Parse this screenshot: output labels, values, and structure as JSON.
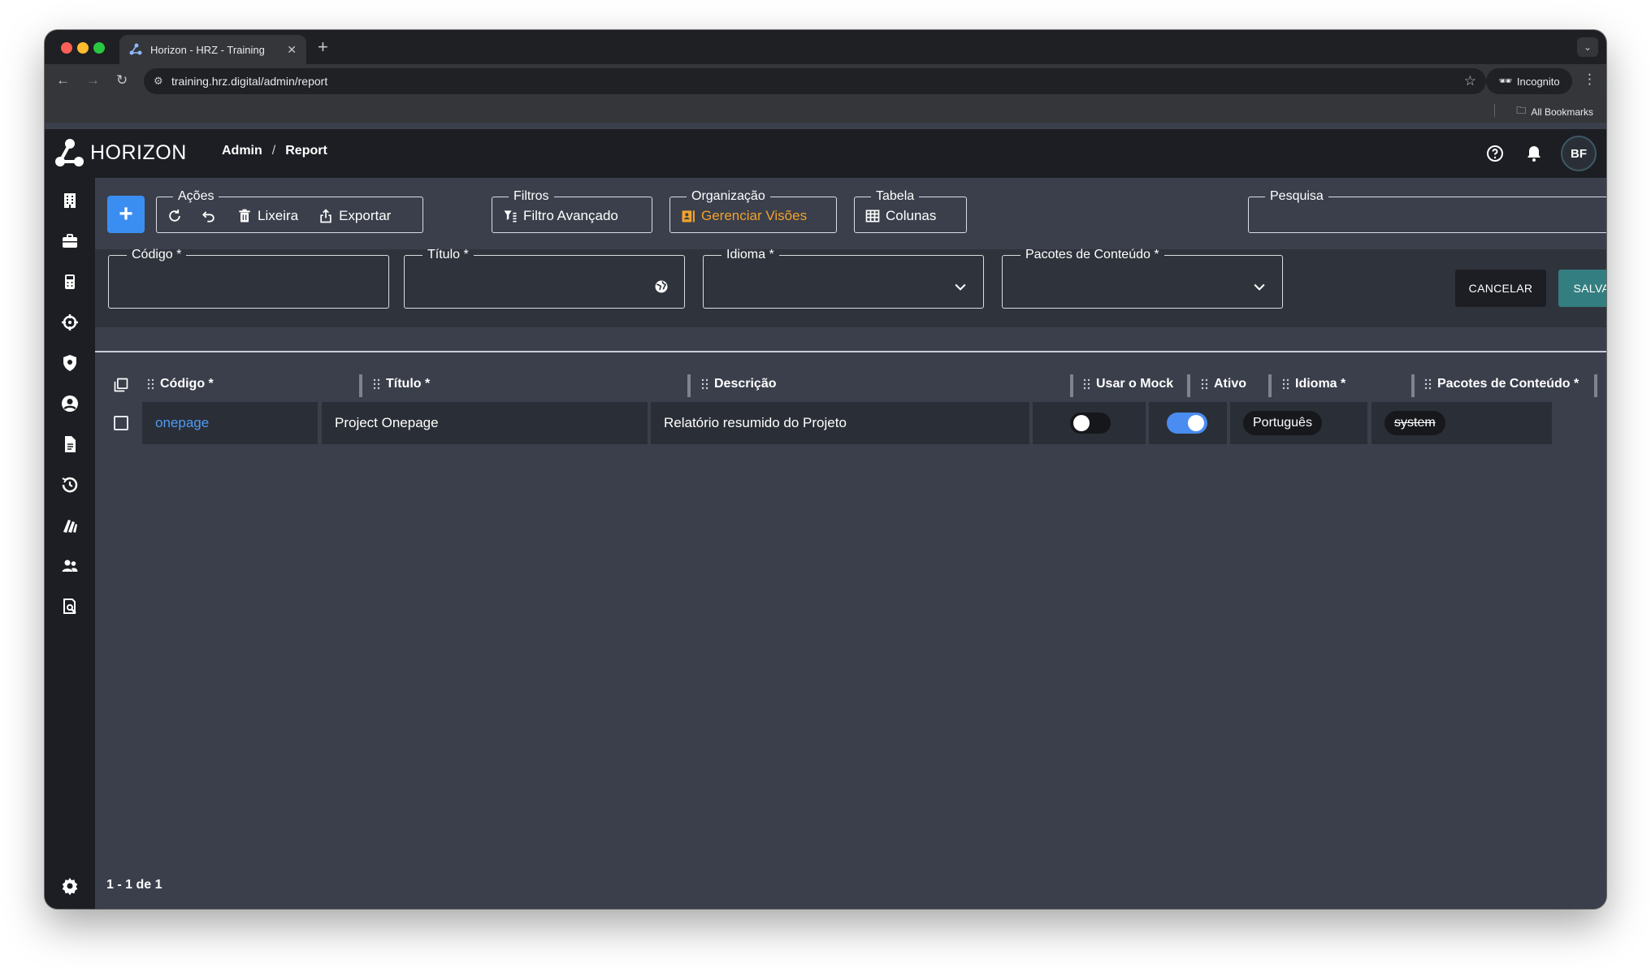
{
  "browser": {
    "tab_title": "Horizon - HRZ - Training",
    "url": "training.hrz.digital/admin/report",
    "incognito_label": "Incognito",
    "bookmarks_label": "All Bookmarks"
  },
  "header": {
    "logo_text": "HORIZON",
    "breadcrumb": [
      "Admin",
      "/",
      "Report"
    ],
    "avatar_initials": "BF"
  },
  "sidebar": {
    "icons": [
      "building-icon",
      "briefcase-icon",
      "calculator-icon",
      "crosshair-icon",
      "shield-icon",
      "user-circle-icon",
      "document-icon",
      "history-icon",
      "layers-icon",
      "users-icon",
      "report-search-icon"
    ],
    "bottom_icon": "gear-icon"
  },
  "toolbar": {
    "acoes_legend": "Ações",
    "lixeira_label": "Lixeira",
    "exportar_label": "Exportar",
    "filtros_legend": "Filtros",
    "filtro_avancado_label": "Filtro Avançado",
    "organizacao_legend": "Organização",
    "gerenciar_visoes_label": "Gerenciar Visões",
    "tabela_legend": "Tabela",
    "colunas_label": "Colunas",
    "pesquisa_legend": "Pesquisa",
    "pesquisa_value": ""
  },
  "form": {
    "codigo_legend": "Código *",
    "titulo_legend": "Título *",
    "idioma_legend": "Idioma *",
    "pacotes_legend": "Pacotes de Conteúdo *",
    "cancel_label": "CANCELAR",
    "save_label": "SALVAR"
  },
  "table": {
    "columns": [
      "Código *",
      "Título *",
      "Descrição",
      "Usar o Mock",
      "Ativo",
      "Idioma *",
      "Pacotes de Conteúdo *"
    ],
    "rows": [
      {
        "codigo": "onepage",
        "titulo": "Project Onepage",
        "descricao": "Relatório resumido do Projeto",
        "usar_mock": false,
        "ativo": true,
        "idioma": "Português",
        "pacotes": "system"
      }
    ]
  },
  "pagination": {
    "text": "1 - 1 de 1"
  },
  "colors": {
    "accent_blue": "#3b8ef1",
    "save_teal": "#337e80",
    "orange": "#f2a12b",
    "link_blue": "#4e9af5"
  }
}
